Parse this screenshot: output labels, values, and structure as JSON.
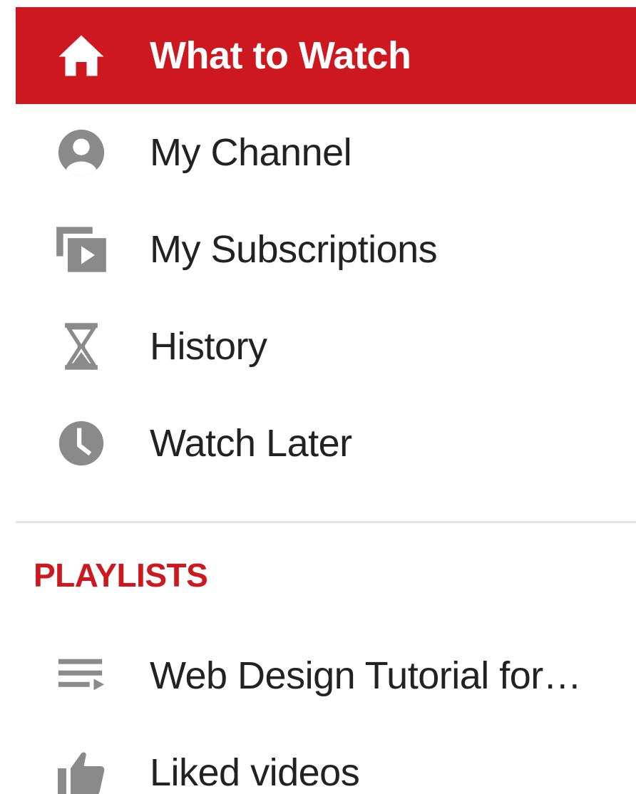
{
  "colors": {
    "accent": "#cc181e",
    "icon_gray": "#8a8a8a",
    "text": "#222222",
    "divider": "#e5e5e5"
  },
  "nav": {
    "items": [
      {
        "label": "What to Watch",
        "icon": "home-icon",
        "active": true
      },
      {
        "label": "My Channel",
        "icon": "account-icon",
        "active": false
      },
      {
        "label": "My Subscriptions",
        "icon": "subscriptions-icon",
        "active": false
      },
      {
        "label": "History",
        "icon": "hourglass-icon",
        "active": false
      },
      {
        "label": "Watch Later",
        "icon": "clock-icon",
        "active": false
      }
    ]
  },
  "playlists": {
    "title": "PLAYLISTS",
    "items": [
      {
        "label": "Web Design Tutorial for…",
        "icon": "playlist-icon"
      },
      {
        "label": "Liked videos",
        "icon": "thumbs-up-icon"
      }
    ]
  }
}
